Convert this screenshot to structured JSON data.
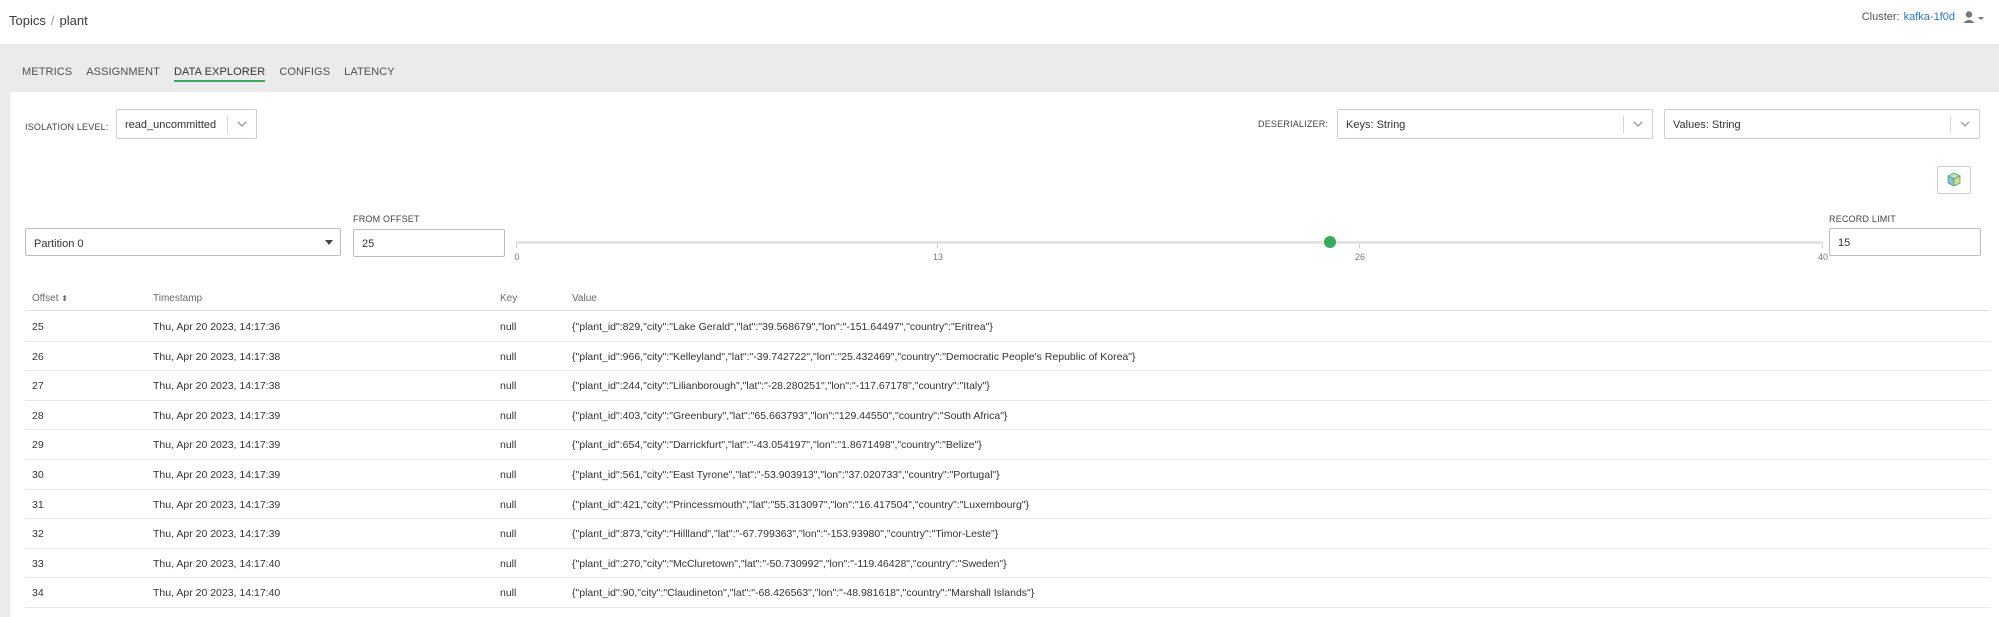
{
  "breadcrumb": {
    "root": "Topics",
    "separator": "/",
    "current": "plant"
  },
  "cluster": {
    "label": "Cluster:",
    "name": "kafka-1f0d"
  },
  "tabs": [
    "METRICS",
    "ASSIGNMENT",
    "DATA EXPLORER",
    "CONFIGS",
    "LATENCY"
  ],
  "active_tab": "DATA EXPLORER",
  "isolation": {
    "label": "ISOLATION LEVEL:",
    "value": "read_uncommitted"
  },
  "deserializer": {
    "label": "DESERIALIZER:",
    "keys": "Keys: String",
    "values": "Values: String"
  },
  "partition": {
    "value": "Partition 0"
  },
  "from_offset": {
    "label": "FROM OFFSET",
    "value": "25"
  },
  "slider": {
    "min": 0,
    "max": 40,
    "value": 25,
    "ticks": [
      "0",
      "13",
      "26",
      "40"
    ]
  },
  "record_limit": {
    "label": "RECORD LIMIT",
    "value": "15"
  },
  "table": {
    "headers": {
      "offset": "Offset",
      "sort_glyph": "⬍",
      "timestamp": "Timestamp",
      "key": "Key",
      "value": "Value"
    },
    "rows": [
      {
        "offset": "25",
        "timestamp": "Thu, Apr 20 2023, 14:17:36",
        "key": "null",
        "value": "{\"plant_id\":829,\"city\":\"Lake Gerald\",\"lat\":\"39.568679\",\"lon\":\"-151.64497\",\"country\":\"Eritrea\"}"
      },
      {
        "offset": "26",
        "timestamp": "Thu, Apr 20 2023, 14:17:38",
        "key": "null",
        "value": "{\"plant_id\":966,\"city\":\"Kelleyland\",\"lat\":\"-39.742722\",\"lon\":\"25.432469\",\"country\":\"Democratic People's Republic of Korea\"}"
      },
      {
        "offset": "27",
        "timestamp": "Thu, Apr 20 2023, 14:17:38",
        "key": "null",
        "value": "{\"plant_id\":244,\"city\":\"Lilianborough\",\"lat\":\"-28.280251\",\"lon\":\"-117.67178\",\"country\":\"Italy\"}"
      },
      {
        "offset": "28",
        "timestamp": "Thu, Apr 20 2023, 14:17:39",
        "key": "null",
        "value": "{\"plant_id\":403,\"city\":\"Greenbury\",\"lat\":\"65.663793\",\"lon\":\"129.44550\",\"country\":\"South Africa\"}"
      },
      {
        "offset": "29",
        "timestamp": "Thu, Apr 20 2023, 14:17:39",
        "key": "null",
        "value": "{\"plant_id\":654,\"city\":\"Darrickfurt\",\"lat\":\"-43.054197\",\"lon\":\"1.8671498\",\"country\":\"Belize\"}"
      },
      {
        "offset": "30",
        "timestamp": "Thu, Apr 20 2023, 14:17:39",
        "key": "null",
        "value": "{\"plant_id\":561,\"city\":\"East Tyrone\",\"lat\":\"-53.903913\",\"lon\":\"37.020733\",\"country\":\"Portugal\"}"
      },
      {
        "offset": "31",
        "timestamp": "Thu, Apr 20 2023, 14:17:39",
        "key": "null",
        "value": "{\"plant_id\":421,\"city\":\"Princessmouth\",\"lat\":\"55.313097\",\"lon\":\"16.417504\",\"country\":\"Luxembourg\"}"
      },
      {
        "offset": "32",
        "timestamp": "Thu, Apr 20 2023, 14:17:39",
        "key": "null",
        "value": "{\"plant_id\":873,\"city\":\"Hillland\",\"lat\":\"-67.799363\",\"lon\":\"-153.93980\",\"country\":\"Timor-Leste\"}"
      },
      {
        "offset": "33",
        "timestamp": "Thu, Apr 20 2023, 14:17:40",
        "key": "null",
        "value": "{\"plant_id\":270,\"city\":\"McCluretown\",\"lat\":\"-50.730992\",\"lon\":\"-119.46428\",\"country\":\"Sweden\"}"
      },
      {
        "offset": "34",
        "timestamp": "Thu, Apr 20 2023, 14:17:40",
        "key": "null",
        "value": "{\"plant_id\":90,\"city\":\"Claudineton\",\"lat\":\"-68.426563\",\"lon\":\"-48.981618\",\"country\":\"Marshall Islands\"}"
      }
    ]
  },
  "colors": {
    "accent": "#3aaa5a",
    "link": "#2b77c6",
    "panel_bg": "#ebebeb"
  },
  "icons": {
    "user": "user-icon",
    "chevron": "chevron-down-icon",
    "export": "cube-icon",
    "sort": "sort-icon"
  }
}
